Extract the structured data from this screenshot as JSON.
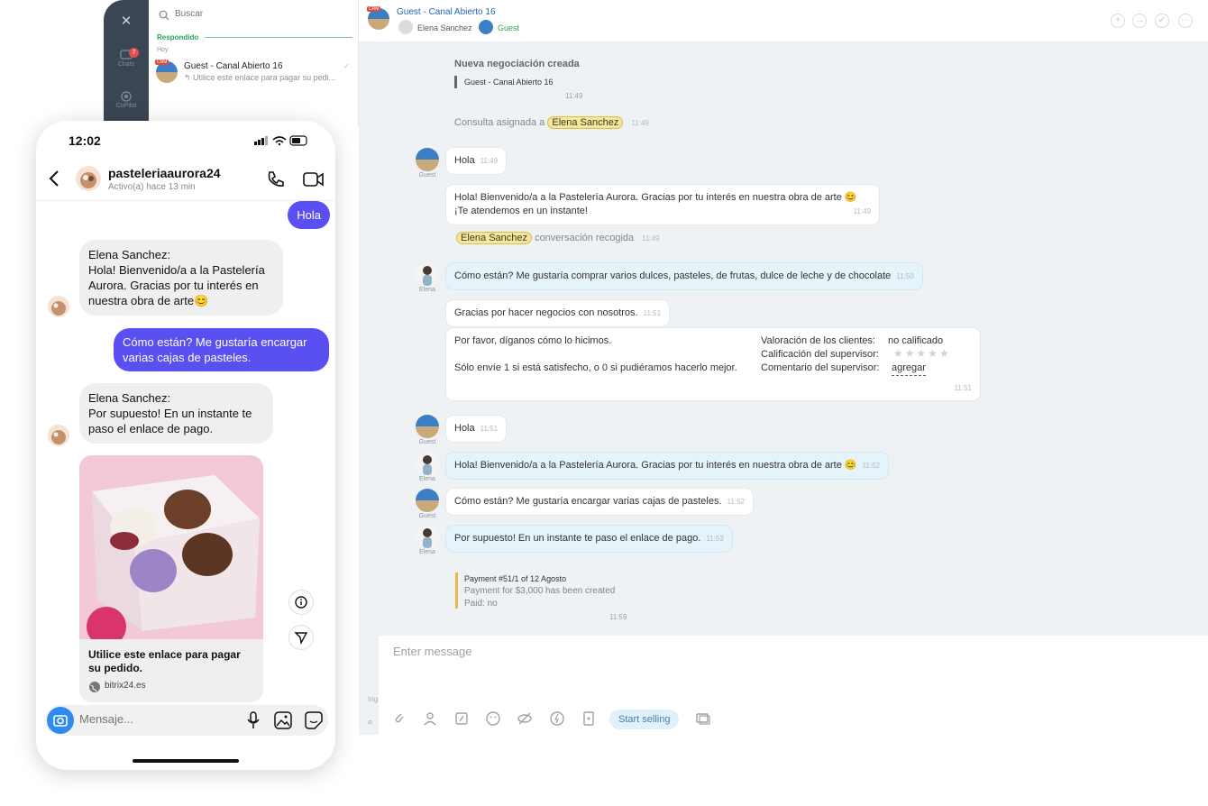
{
  "rail": {
    "chats_label": "Chats",
    "chats_badge": "7",
    "copilot_label": "CoPilot"
  },
  "chat_list": {
    "search_placeholder": "Buscar",
    "section_label": "Respondido",
    "date_label": "Hoy",
    "items": [
      {
        "title": "Guest - Canal Abierto 16",
        "preview": "↰ Utilice este enlace para pagar su pedi...",
        "badge": "CRM"
      }
    ]
  },
  "header": {
    "title": "Guest - Canal Abierto 16",
    "operator": "Elena Sanchez",
    "guest": "Guest",
    "badge": "CRM"
  },
  "messages": {
    "deal_title": "Nueva negociación creada",
    "deal_name": "Guest - Canal Abierto 16",
    "deal_time": "11:49",
    "assigned_text": "Consulta asignada a",
    "assigned_name": "Elena Sanchez",
    "assigned_time": "11:49",
    "m1_text": "Hola",
    "m1_time": "11:49",
    "m2_line1": "Hola! Bienvenido/a a la Pastelería Aurora. Gracias por tu interés en nuestra obra de arte 😊",
    "m2_line2": "¡Te atendemos en un instante!",
    "m2_time": "11:49",
    "picked_name": "Elena Sanchez",
    "picked_text": "conversación recogida",
    "picked_time": "11:49",
    "m3_text": "Cómo están? Me gustaría comprar varios dulces, pasteles, de frutas, dulce de leche y de chocolate",
    "m3_time": "11:50",
    "m4_text": "Gracias por hacer negocios con nosotros.",
    "m4_time": "11:51",
    "rating_line1": "Por favor, díganos cómo lo hicimos.",
    "rating_line2": "Sólo envíe 1 si está satisfecho, o 0 si pudiéramos hacerlo mejor.",
    "rating_label1": "Valoración de los clientes:",
    "rating_value1": "no calificado",
    "rating_label2": "Calificación del supervisor:",
    "rating_stars": "★★★★★",
    "rating_label3": "Comentario del supervisor:",
    "rating_value3": "agregar",
    "rating_time": "11:51",
    "m5_text": "Hola",
    "m5_time": "11:51",
    "m6_text": "Hola! Bienvenido/a a la Pastelería Aurora. Gracias por tu interés en nuestra obra de arte 😊",
    "m6_time": "11:52",
    "m7_text": "Cómo están? Me gustaría encargar varias cajas de pasteles.",
    "m7_time": "11:52",
    "m8_text": "Por supuesto! En un instante te paso el enlace de pago.",
    "m8_time": "11:53",
    "pay_title": "Payment #51/1 of 12 Agosto",
    "pay_line": "Payment for $3,000 has been created",
    "pay_paid": "Paid: no",
    "pay_time": "11:59",
    "guest_label": "Guest",
    "elena_label": "Elena"
  },
  "composer": {
    "placeholder": "Enter message",
    "start_selling": "Start selling",
    "partial_label": "Ing"
  },
  "phone": {
    "time": "12:02",
    "contact_name": "pasteleriaaurora24",
    "contact_status": "Activo(a) hace 13 min",
    "out1": "Hola",
    "in1_name": "Elena Sanchez:",
    "in1_text": "Hola! Bienvenido/a a la Pastelería Aurora. Gracias por tu interés en nuestra obra de arte😊",
    "out2": "Cómo están? Me gustaría encargar varias cajas de pasteles.",
    "in2_name": "Elena Sanchez:",
    "in2_text": "Por supuesto! En un instante te paso el enlace de pago.",
    "card_title": "Utilice este enlace para pagar su pedido.",
    "card_url": "bitrix24.es",
    "compose_placeholder": "Mensaje..."
  },
  "colors": {
    "accent": "#2066b0",
    "phone_bubble": "#5a4ff0",
    "tag_bg": "#f7e69b",
    "green": "#2fa35a"
  }
}
